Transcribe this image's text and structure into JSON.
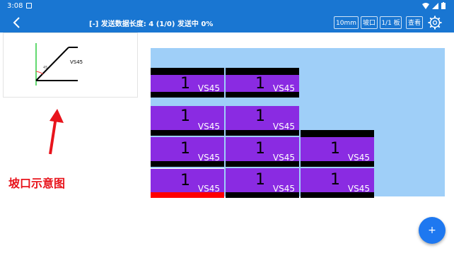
{
  "status": {
    "time": "3:08"
  },
  "appbar": {
    "title": "[-] 发送数据长度: 4 (1/0) 发送中 0%",
    "btn_size": "10mm",
    "btn_bevel": "坡口",
    "btn_page": "1/1 板",
    "btn_view": "查看"
  },
  "preview": {
    "label": "VS45",
    "angle_mark": "45"
  },
  "caption": "坡口示意图",
  "cells": [
    {
      "num": "1",
      "label": "VS45"
    },
    {
      "num": "1",
      "label": "VS45"
    },
    {
      "num": "1",
      "label": "VS45"
    },
    {
      "num": "1",
      "label": "VS45"
    },
    {
      "num": "1",
      "label": "VS45"
    },
    {
      "num": "1",
      "label": "VS45"
    },
    {
      "num": "1",
      "label": "VS45"
    },
    {
      "num": "1",
      "label": "VS45"
    },
    {
      "num": "1",
      "label": "VS45"
    },
    {
      "num": "1",
      "label": "VS45"
    }
  ],
  "fab": "+",
  "colors": {
    "appbar": "#1976d2",
    "board": "#9fcff8",
    "cell": "#8a2be2",
    "caption": "#e8141c",
    "fab": "#1e78f0"
  }
}
